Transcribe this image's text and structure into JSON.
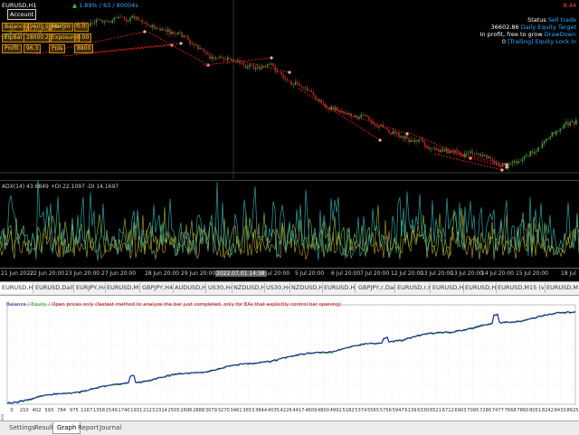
{
  "chart": {
    "symbol_label": "EURUSD,H1",
    "change_label": "1.89% / 63 / 80004s",
    "account_button": "Account",
    "info_rows": [
      [
        "Balance",
        "29600.9",
        "Margin",
        "0.0"
      ],
      [
        "Eq/Bal",
        "28000.2",
        "Exposure",
        "0.00"
      ],
      [
        "Profit",
        "96.3",
        "Pnls",
        "8800"
      ]
    ],
    "status_label": "Status",
    "status_value": "Sell trade",
    "target_value": "36602.86",
    "target_label": "Daily Equity Target",
    "grow_prefix": "In profit, free to grow",
    "grow_label": "DrawDown",
    "trailing_prefix": "0",
    "trailing_label": "[Trailing] Equity Lock in",
    "badge": "8.44"
  },
  "indicator": {
    "label": "ADX(14) 43.6849 +DI 22.1097 -DI 14.1697"
  },
  "time_axis": [
    "21 Jun 2022",
    "22 Jun 20:00",
    "23 Jun 20:00",
    "27 Jun 20:00",
    "28 Jun 20:00",
    "29 Jun 20:00",
    "2022.07.01 14:30",
    "4 Jul 20:00",
    "5 Jul 20:00",
    "6 Jul 20:00",
    "7 Jul 20:00",
    "12 Jul 20:00",
    "13 Jul 20:00",
    "13 Jul 20:00",
    "14 Jul 20:00",
    "15 Jul 20:00",
    "18 Jul"
  ],
  "tabs": [
    "EURUSD,H1",
    "EURUSD,Daily",
    "EURJPY,H4",
    "EURUSD,M5",
    "GBPJPY,H4",
    "AUDUSD,H4",
    "US30,H4",
    "NZDUSD,H4",
    "US30,H4",
    "NZDUSD,H4",
    "EURUSD,H1",
    "GBPJPY,r,Daily",
    "EURUSD,r,H4",
    "EURUSD,H4",
    "EURUSD,H1",
    "EURUSD,M15 (visual)",
    "EURUSD,M15"
  ],
  "graph": {
    "legend_balance": "Balance",
    "legend_equity": "Equity",
    "legend_note": "Open prices only (fastest method to analyze the bar just completed, only for EAs that explicitly control bar opening)",
    "x_ticks": [
      "0",
      "210",
      "402",
      "593",
      "784",
      "975",
      "1167",
      "1358",
      "1549",
      "1740",
      "1931",
      "2123",
      "2314",
      "2505",
      "2696",
      "2888",
      "3079",
      "3270",
      "3461",
      "3653",
      "3844",
      "4035",
      "4226",
      "4417",
      "4609",
      "4800",
      "4991",
      "5182",
      "5374",
      "5565",
      "5756",
      "5947",
      "6139",
      "6330",
      "6521",
      "6712",
      "6903",
      "7095",
      "7286",
      "7477",
      "7668",
      "7860",
      "8051",
      "8242",
      "8433",
      "8625"
    ],
    "side_label": "Terminal"
  },
  "bottom_tabs": [
    "Settings",
    "Results",
    "Graph",
    "Report",
    "Journal"
  ],
  "colors": {
    "candle_bull": "#2e9e3c",
    "candle_bear": "#b02828",
    "trade_line": "#ff2020",
    "balance": "#1f2f9f",
    "equity": "#22aa22",
    "adx": "#2fa0a0",
    "plus_di": "#8fbf40",
    "minus_di": "#bf9f30"
  }
}
